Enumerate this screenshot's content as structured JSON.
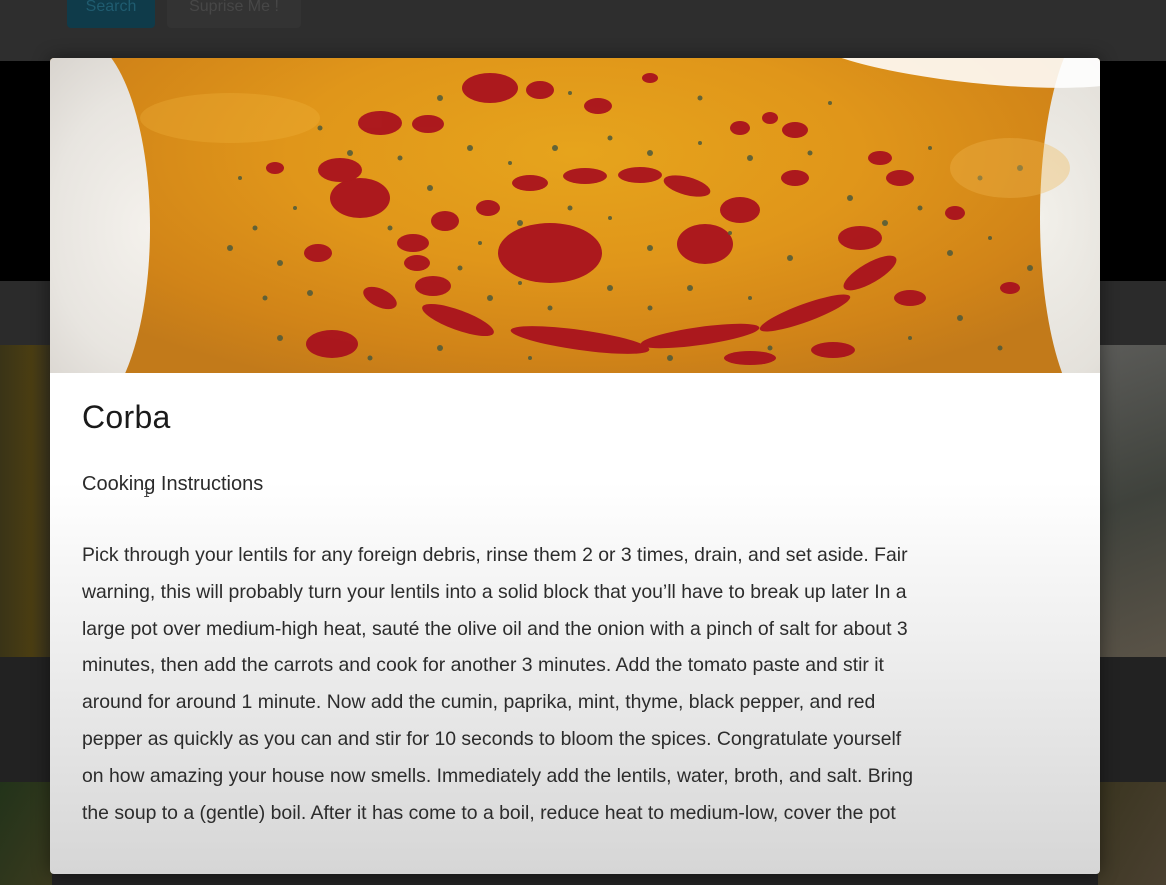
{
  "background_page": {
    "search_button_label": "Search",
    "surprise_button_label": "Suprise Me !"
  },
  "modal": {
    "image_alt": "Corba",
    "title": "Corba",
    "section_heading": "Cooking Instructions",
    "instructions": "Pick through your lentils for any foreign debris, rinse them 2 or 3 times, drain, and set aside. Fair warning, this will probably turn your lentils into a solid block that you’ll have to break up later In a large pot over medium-high heat, sauté the olive oil and the onion with a pinch of salt for about 3 minutes, then add the carrots and cook for another 3 minutes. Add the tomato paste and stir it around for around 1 minute. Now add the cumin, paprika, mint, thyme, black pepper, and red pepper as quickly as you can and stir for 10 seconds to bloom the spices. Congratulate yourself on how amazing your house now smells. Immediately add the lentils, water, broth, and salt. Bring the soup to a (gentle) boil. After it has come to a boil, reduce heat to medium-low, cover the pot"
  },
  "colors": {
    "overlay_backdrop": "#1c1c1c",
    "modal_background": "#ffffff",
    "soup": "#e0961a",
    "chili_oil": "#b0101c",
    "herbs": "#5e6a4a",
    "search_button": "#0f3b4a"
  },
  "icons": {
    "cursor": "text-cursor-icon"
  }
}
